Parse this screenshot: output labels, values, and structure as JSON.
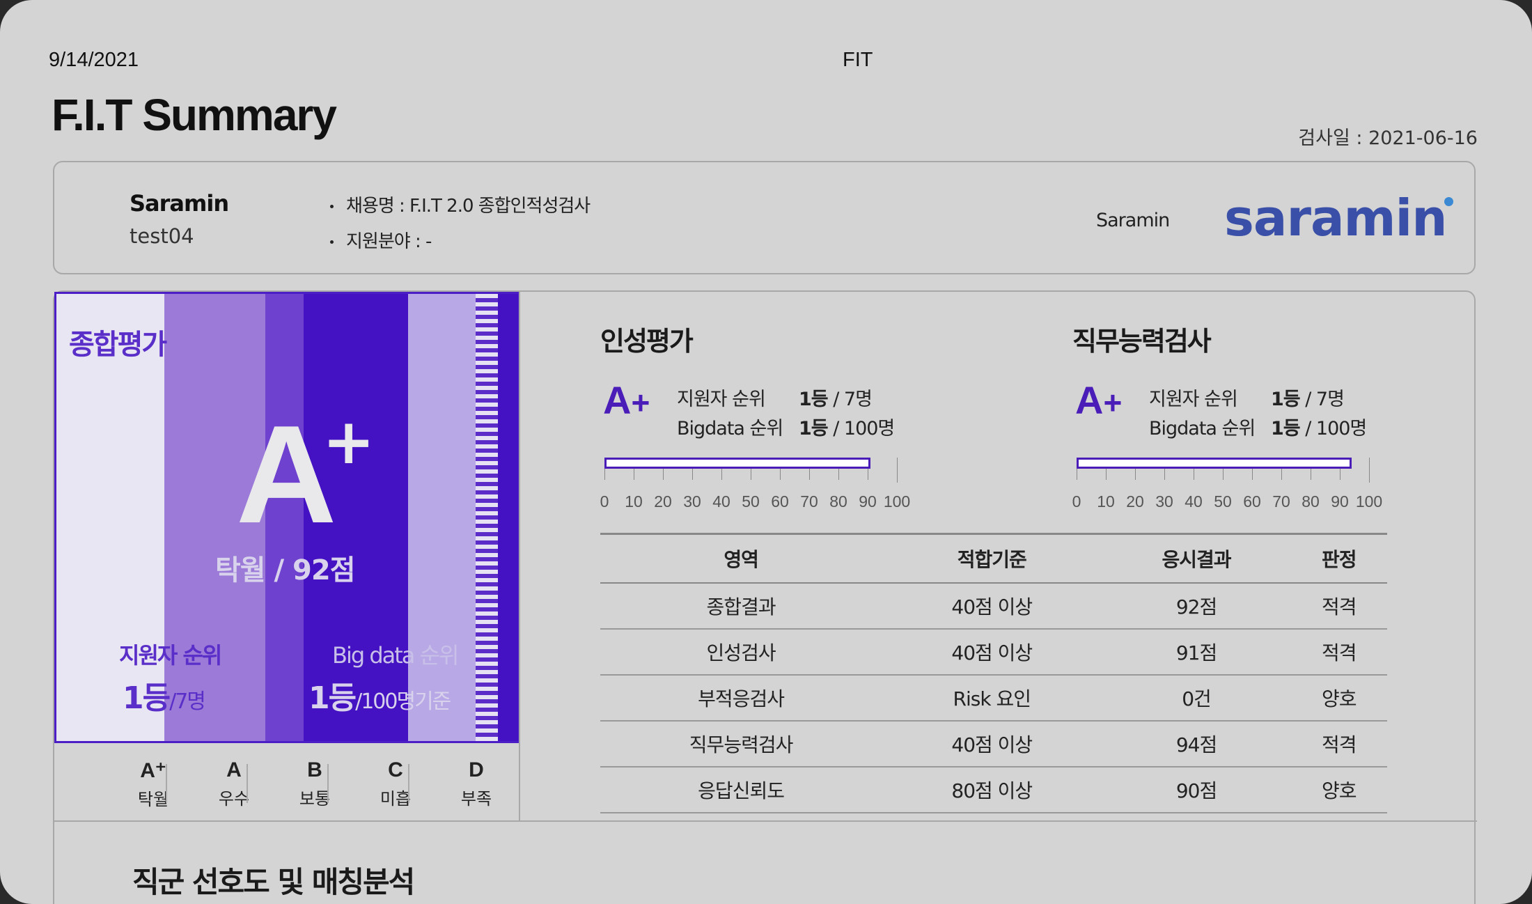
{
  "header": {
    "print_date": "9/14/2021",
    "print_title": "FIT",
    "main_title": "F.I.T Summary",
    "test_date": "검사일 : 2021-06-16"
  },
  "info": {
    "company": "Saramin",
    "user_id": "test04",
    "recruit": "채용명 : F.I.T 2.0 종합인적성검사",
    "field": "지원분야 : -",
    "company_right": "Saramin",
    "logo_text": "saramin",
    "logo_color": "#3a4fa8"
  },
  "overall": {
    "label": "종합평가",
    "grade": "A",
    "grade_plus": "+",
    "desc": "탁월 / 92점",
    "applicant_rank_label": "지원자 순위",
    "applicant_rank": "1등",
    "applicant_total": "/7명",
    "bigdata_rank_label": "Big data 순위",
    "bigdata_rank": "1등",
    "bigdata_total": "/100명기준",
    "accent_color": "#4412c2"
  },
  "legend": [
    {
      "grade": "A⁺",
      "text": "탁월"
    },
    {
      "grade": "A",
      "text": "우수"
    },
    {
      "grade": "B",
      "text": "보통"
    },
    {
      "grade": "C",
      "text": "미흡"
    },
    {
      "grade": "D",
      "text": "부족"
    }
  ],
  "sections": [
    {
      "title": "인성평가",
      "grade": "A",
      "grade_plus": "+",
      "applicant_label": "지원자 순위",
      "applicant_rank": "1등",
      "applicant_total": " / 7명",
      "bigdata_label": "Bigdata 순위",
      "bigdata_rank": "1등",
      "bigdata_total": " / 100명",
      "score": 91
    },
    {
      "title": "직무능력검사",
      "grade": "A",
      "grade_plus": "+",
      "applicant_label": "지원자 순위",
      "applicant_rank": "1등",
      "applicant_total": " / 7명",
      "bigdata_label": "Bigdata 순위",
      "bigdata_rank": "1등",
      "bigdata_total": " / 100명",
      "score": 94
    }
  ],
  "scale_ticks": [
    "0",
    "10",
    "20",
    "30",
    "40",
    "50",
    "60",
    "70",
    "80",
    "90",
    "100"
  ],
  "table": {
    "headers": [
      "영역",
      "적합기준",
      "응시결과",
      "판정"
    ],
    "rows": [
      [
        "종합결과",
        "40점 이상",
        "92점",
        "적격"
      ],
      [
        "인성검사",
        "40점 이상",
        "91점",
        "적격"
      ],
      [
        "부적응검사",
        "Risk 요인",
        "0건",
        "양호"
      ],
      [
        "직무능력검사",
        "40점 이상",
        "94점",
        "적격"
      ],
      [
        "응답신뢰도",
        "80점 이상",
        "90점",
        "양호"
      ]
    ]
  },
  "bottom_title": "직군 선호도 및 매칭분석"
}
